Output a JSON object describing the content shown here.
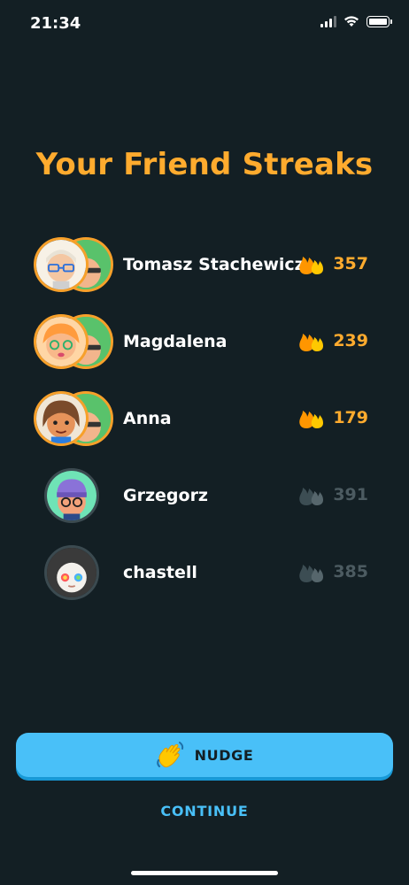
{
  "status_bar": {
    "time": "21:34"
  },
  "title": "Your Friend Streaks",
  "friends": [
    {
      "name": "Tomasz Stachewicz",
      "streak": "357",
      "active": true
    },
    {
      "name": "Magdalena",
      "streak": "239",
      "active": true
    },
    {
      "name": "Anna",
      "streak": "179",
      "active": true
    },
    {
      "name": "Grzegorz",
      "streak": "391",
      "active": false
    },
    {
      "name": "chastell",
      "streak": "385",
      "active": false
    }
  ],
  "actions": {
    "nudge_label": "NUDGE",
    "continue_label": "CONTINUE"
  },
  "colors": {
    "background": "#131f24",
    "accent_orange": "#ffab2e",
    "button_blue": "#49c0f8",
    "inactive_gray": "#4c5b61"
  },
  "icons": [
    "signal-icon",
    "wifi-icon",
    "battery-icon",
    "streak-flame-icon",
    "waving-hand-icon"
  ]
}
